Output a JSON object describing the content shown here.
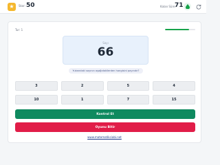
{
  "header": {
    "score_label": "Skor:",
    "score_value": "50",
    "level_label": "Kalan Süre:",
    "level_value": "71",
    "icons": [
      "star-icon",
      "drop-icon",
      "refresh-icon"
    ]
  },
  "game": {
    "time_label": "Tur: 1",
    "progress_fraction": 0.8,
    "sum_label": "Sayı",
    "target_number": "66",
    "question": "Yukarıdaki sayının aşağıdakilerden hangisini payındır?",
    "numbers": [
      "3",
      "2",
      "5",
      "4",
      "10",
      "1",
      "7",
      "15"
    ],
    "check_label": "Kontrol Et",
    "end_label": "Oyunu Bitir",
    "site_link": "www.matematikciabi.net"
  },
  "colors": {
    "accent_green": "#0f8a5f",
    "accent_red": "#e11d48",
    "star_yellow": "#f5b82e",
    "progress_green": "#16a34a"
  }
}
